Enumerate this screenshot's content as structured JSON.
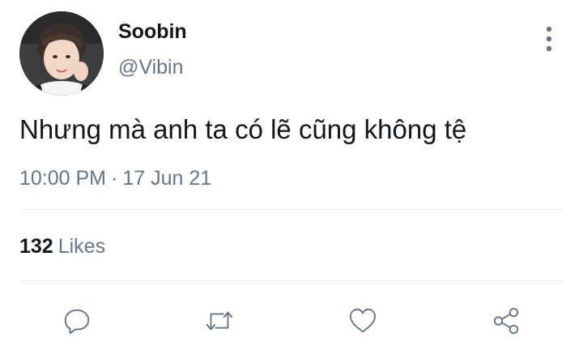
{
  "author": {
    "display_name": "Soobin",
    "handle": "@Vibin"
  },
  "tweet": {
    "text": "Nhưng mà anh ta có lẽ cũng không tệ",
    "time": "10:00 PM",
    "separator": "·",
    "date": "17 Jun 21"
  },
  "stats": {
    "likes_count": "132",
    "likes_label": "Likes"
  },
  "icons": {
    "more": "more-vertical-icon",
    "reply": "reply-icon",
    "retweet": "retweet-icon",
    "like": "heart-icon",
    "share": "share-icon"
  },
  "colors": {
    "primary_text": "#14171a",
    "secondary_text": "#657786",
    "divider": "#e1e8ed",
    "icon": "#657786"
  }
}
